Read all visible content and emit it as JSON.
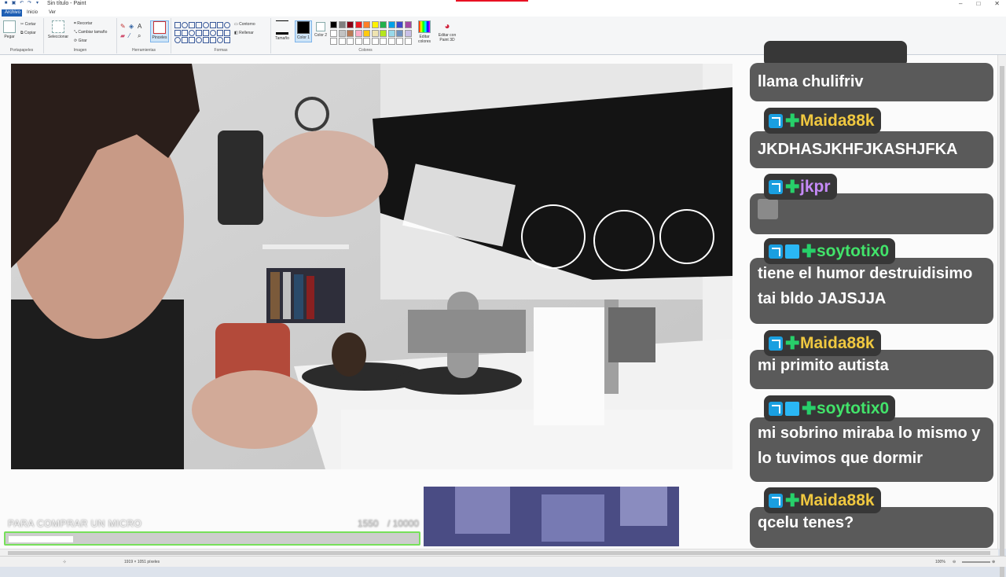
{
  "window": {
    "title": "Sin título - Paint"
  },
  "menu": {
    "file_label": "Archivo",
    "tabs": [
      "Inicio",
      "Ver"
    ]
  },
  "ribbon": {
    "groups": {
      "clipboard": "Portapapeles",
      "image": "Imagen",
      "tools": "Herramientas",
      "shapes": "Formas",
      "colors": "Colores"
    },
    "paste_label": "Pegar",
    "cut_label": "Cortar",
    "copy_label": "Copiar",
    "select_label": "Seleccionar",
    "crop_label": "Recortar",
    "resize_label": "Cambiar tamaño",
    "rotate_label": "Girar",
    "brushes_label": "Pinceles",
    "outline_label": "Contorno",
    "fill_label": "Rellenar",
    "size_label": "Tamaño",
    "color1_label": "Color 1",
    "color2_label": "Color 2",
    "edit_colors_label": "Editar colores",
    "paint3d_label": "Editar con Paint 3D",
    "palette": [
      "#000000",
      "#7f7f7f",
      "#880015",
      "#ed1c24",
      "#ff7f27",
      "#fff200",
      "#22b14c",
      "#00a2e8",
      "#3f48cc",
      "#a349a4",
      "#ffffff",
      "#c3c3c3",
      "#b97a57",
      "#ffaec9",
      "#ffc90e",
      "#efe4b0",
      "#b5e61d",
      "#99d9ea",
      "#7092be",
      "#c8bfe7"
    ]
  },
  "status": {
    "selection": "1919 × 1051 píxeles",
    "zoom": "100%"
  },
  "goal": {
    "label": "PARA COMPRAR UN MICRO",
    "current": "1550",
    "target": "/ 10000",
    "progress": 0.155,
    "color": "#77e05a"
  },
  "chat": [
    {
      "user": "",
      "user_color": "#f4d94a",
      "badges": [],
      "text": "llama chulifriv",
      "partial": true
    },
    {
      "user": "Maida88k",
      "user_color": "#f0c840",
      "badges": [
        "prime-icon",
        "plus-icon"
      ],
      "text": "JKDHASJKHFJKASHJFKA"
    },
    {
      "user": "jkpr",
      "user_color": "#c58af7",
      "badges": [
        "prime-icon",
        "plus-icon"
      ],
      "text": "",
      "emote": "emote-icon"
    },
    {
      "user": "soytotix0",
      "user_color": "#42e36a",
      "badges": [
        "prime-icon",
        "cube-icon",
        "plus-icon"
      ],
      "text_lines": [
        "tiene el humor destruidisimo",
        "tai bldo JAJSJJA"
      ]
    },
    {
      "user": "Maida88k",
      "user_color": "#f0c840",
      "badges": [
        "prime-icon",
        "plus-icon"
      ],
      "text": "mi primito autista"
    },
    {
      "user": "soytotix0",
      "user_color": "#42e36a",
      "badges": [
        "prime-icon",
        "cube-icon",
        "plus-icon"
      ],
      "text_lines": [
        "mi sobrino miraba lo mismo y",
        "lo tuvimos que dormir"
      ]
    },
    {
      "user": "Maida88k",
      "user_color": "#f0c840",
      "badges": [
        "prime-icon",
        "plus-icon"
      ],
      "text": "qcelu tenes?"
    }
  ]
}
